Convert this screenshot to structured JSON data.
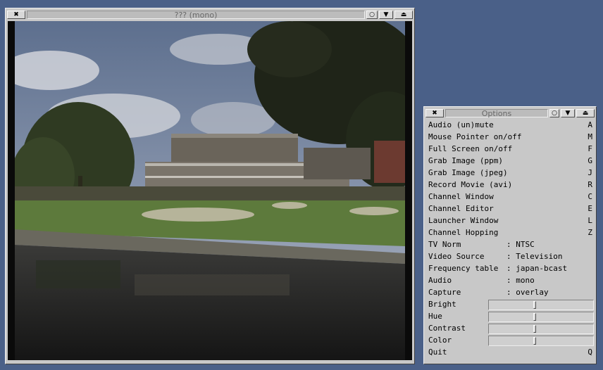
{
  "video_window": {
    "title": "??? (mono)",
    "close_glyph": "✖",
    "iconify_glyph": "○",
    "menu_glyph": "▼",
    "maximize_glyph": "⏏"
  },
  "options_window": {
    "title": "Options",
    "close_glyph": "✖",
    "iconify_glyph": "○",
    "menu_glyph": "▼",
    "maximize_glyph": "⏏",
    "menu_items": [
      {
        "label": "Audio (un)mute",
        "key": "A"
      },
      {
        "label": "Mouse Pointer on/off",
        "key": "M"
      },
      {
        "label": "Full Screen on/off",
        "key": "F"
      },
      {
        "label": "Grab Image (ppm)",
        "key": "G"
      },
      {
        "label": "Grab Image (jpeg)",
        "key": "J"
      },
      {
        "label": "Record Movie (avi)",
        "key": "R"
      },
      {
        "label": "Channel Window",
        "key": "C"
      },
      {
        "label": "Channel Editor",
        "key": "E"
      },
      {
        "label": "Launcher Window",
        "key": "L"
      },
      {
        "label": "Channel Hopping",
        "key": "Z"
      }
    ],
    "settings": [
      {
        "label": "TV Norm",
        "value": ": NTSC"
      },
      {
        "label": "Video Source",
        "value": ": Television"
      },
      {
        "label": "Frequency table",
        "value": ": japan-bcast"
      },
      {
        "label": "Audio",
        "value": ": mono"
      },
      {
        "label": "Capture",
        "value": ": overlay"
      }
    ],
    "sliders": [
      {
        "label": "Bright",
        "level": 0.44
      },
      {
        "label": "Hue",
        "level": 0.44
      },
      {
        "label": "Contrast",
        "level": 0.44
      },
      {
        "label": "Color",
        "level": 0.44
      }
    ],
    "quit": {
      "label": "Quit",
      "key": "Q"
    }
  }
}
